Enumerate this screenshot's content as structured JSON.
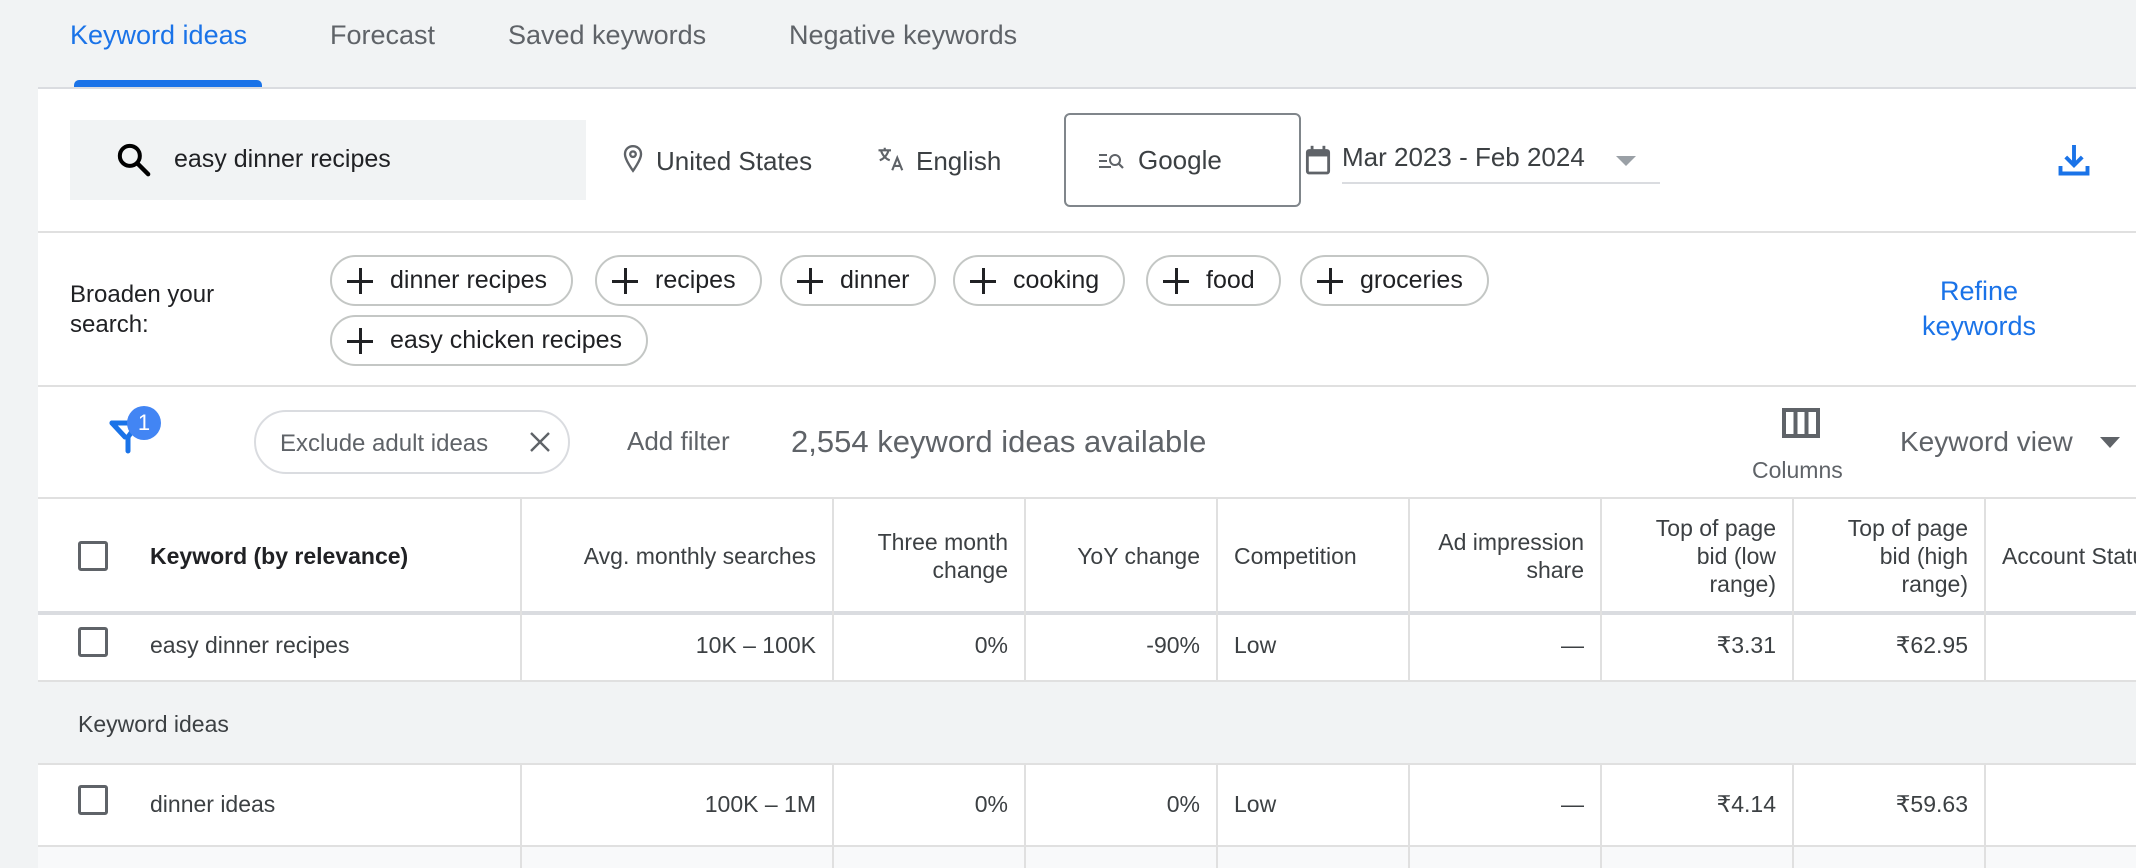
{
  "tabs": [
    {
      "label": "Keyword ideas",
      "active": true
    },
    {
      "label": "Forecast",
      "active": false
    },
    {
      "label": "Saved keywords",
      "active": false
    },
    {
      "label": "Negative keywords",
      "active": false
    }
  ],
  "search": {
    "query": "easy dinner recipes",
    "location": "United States",
    "language": "English",
    "network": "Google",
    "date_range": "Mar 2023 - Feb 2024"
  },
  "broaden": {
    "label": "Broaden your search:",
    "chips": [
      "dinner recipes",
      "recipes",
      "dinner",
      "cooking",
      "food",
      "groceries",
      "easy chicken recipes"
    ],
    "refine_label": "Refine keywords"
  },
  "filters": {
    "active_count": "1",
    "chip_label": "Exclude adult ideas",
    "add_filter": "Add filter",
    "count_text": "2,554 keyword ideas available",
    "columns_label": "Columns",
    "view_label": "Keyword view"
  },
  "table": {
    "columns": [
      "Keyword (by relevance)",
      "Avg. monthly searches",
      "Three month change",
      "YoY change",
      "Competition",
      "Ad impression share",
      "Top of page bid (low range)",
      "Top of page bid (high range)",
      "Account Status"
    ],
    "provided_rows": [
      {
        "keyword": "easy dinner recipes",
        "avg_searches": "10K – 100K",
        "three_month": "0%",
        "yoy": "-90%",
        "competition": "Low",
        "ad_share": "—",
        "bid_low": "₹3.31",
        "bid_high": "₹62.95",
        "status": ""
      }
    ],
    "section_label": "Keyword ideas",
    "idea_rows": [
      {
        "keyword": "dinner ideas",
        "avg_searches": "100K – 1M",
        "three_month": "0%",
        "yoy": "0%",
        "competition": "Low",
        "ad_share": "—",
        "bid_low": "₹4.14",
        "bid_high": "₹59.63",
        "status": ""
      }
    ]
  },
  "colors": {
    "accent": "#1a73e8",
    "badge": "#4285f4",
    "background": "#f1f3f4"
  }
}
